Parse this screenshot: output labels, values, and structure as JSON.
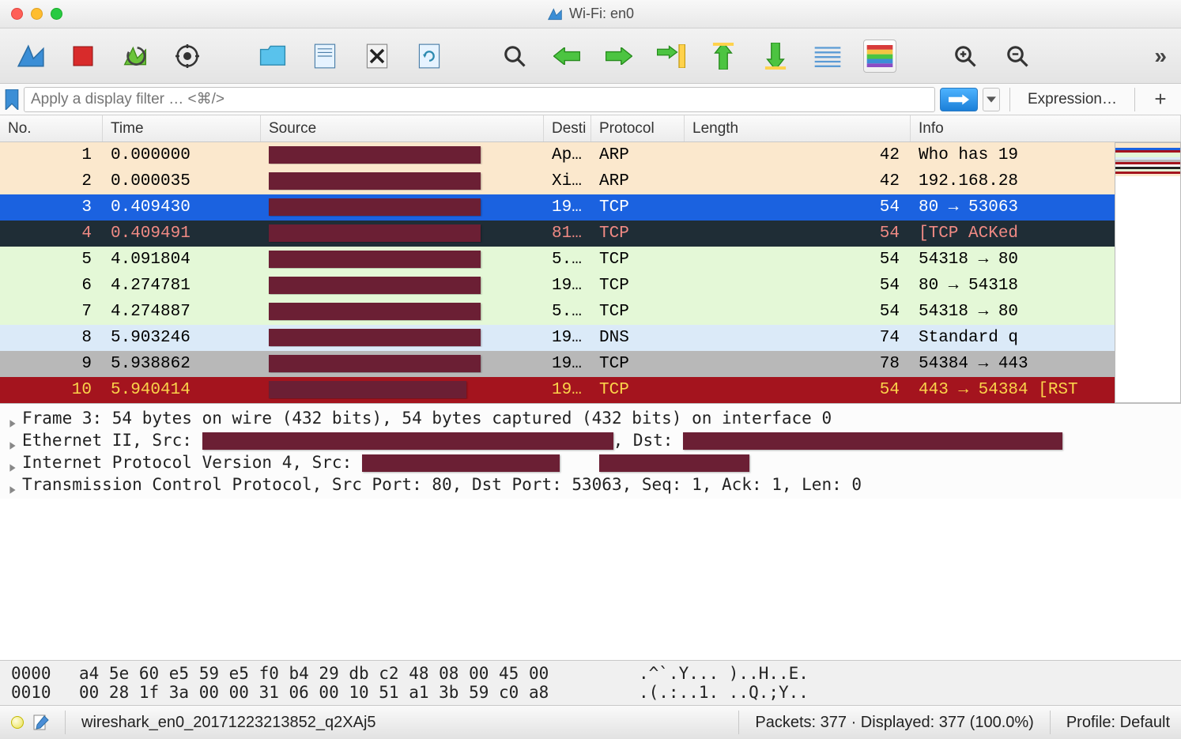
{
  "window": {
    "title": "Wi-Fi: en0"
  },
  "filter": {
    "placeholder": "Apply a display filter … <⌘/>",
    "expression_label": "Expression…"
  },
  "columns": {
    "no": "No.",
    "time": "Time",
    "source": "Source",
    "dest": "Desti",
    "proto": "Protocol",
    "len": "Length",
    "info": "Info"
  },
  "packets": [
    {
      "no": "1",
      "time": "0.000000",
      "dest": "Ap…",
      "proto": "ARP",
      "len": "42",
      "info": "Who has 19",
      "cls": "arp",
      "redact_w": 268
    },
    {
      "no": "2",
      "time": "0.000035",
      "dest": "Xi…",
      "proto": "ARP",
      "len": "42",
      "info": "192.168.28",
      "cls": "arp",
      "redact_w": 268
    },
    {
      "no": "3",
      "time": "0.409430",
      "dest": "19…",
      "proto": "TCP",
      "len": "54",
      "info": "80 → 53063",
      "cls": "sel-blue",
      "redact_w": 268
    },
    {
      "no": "4",
      "time": "0.409491",
      "dest": "81…",
      "proto": "TCP",
      "len": "54",
      "info": "[TCP ACKed",
      "cls": "sel-dark",
      "redact_w": 268
    },
    {
      "no": "5",
      "time": "4.091804",
      "dest": "5.…",
      "proto": "TCP",
      "len": "54",
      "info": "54318 → 80",
      "cls": "tcp-ok",
      "redact_w": 268
    },
    {
      "no": "6",
      "time": "4.274781",
      "dest": "19…",
      "proto": "TCP",
      "len": "54",
      "info": "80 → 54318",
      "cls": "tcp-ok",
      "redact_w": 268
    },
    {
      "no": "7",
      "time": "4.274887",
      "dest": "5.…",
      "proto": "TCP",
      "len": "54",
      "info": "54318 → 80",
      "cls": "tcp-ok",
      "redact_w": 268
    },
    {
      "no": "8",
      "time": "5.903246",
      "dest": "19…",
      "proto": "DNS",
      "len": "74",
      "info": "Standard q",
      "cls": "dns",
      "redact_w": 268
    },
    {
      "no": "9",
      "time": "5.938862",
      "dest": "19…",
      "proto": "TCP",
      "len": "78",
      "info": "54384 → 443",
      "cls": "tcp-gray",
      "redact_w": 268
    },
    {
      "no": "10",
      "time": "5.940414",
      "dest": "19…",
      "proto": "TCP",
      "len": "54",
      "info": "443 → 54384 [RST",
      "cls": "tcp-red",
      "redact_w": 250
    }
  ],
  "details": {
    "l1": "Frame 3: 54 bytes on wire (432 bits), 54 bytes captured (432 bits) on interface 0",
    "l2a": "Ethernet II, Src: ",
    "l2b": ", Dst: ",
    "l3a": "Internet Protocol Version 4, Src: ",
    "l4": "Transmission Control Protocol, Src Port: 80, Dst Port: 53063, Seq: 1, Ack: 1, Len: 0"
  },
  "hex": [
    {
      "off": "0000",
      "bytes": "a4 5e 60 e5 59 e5 f0 b4  29 db c2 48 08 00 45 00",
      "ascii": ".^`.Y... )..H..E."
    },
    {
      "off": "0010",
      "bytes": "00 28 1f 3a 00 00 31 06  00 10 51 a1 3b 59 c0 a8",
      "ascii": ".(.:..1. ..Q.;Y.."
    }
  ],
  "status": {
    "file": "wireshark_en0_20171223213852_q2XAj5",
    "packets": "Packets: 377 · Displayed: 377 (100.0%)",
    "profile": "Profile: Default"
  }
}
